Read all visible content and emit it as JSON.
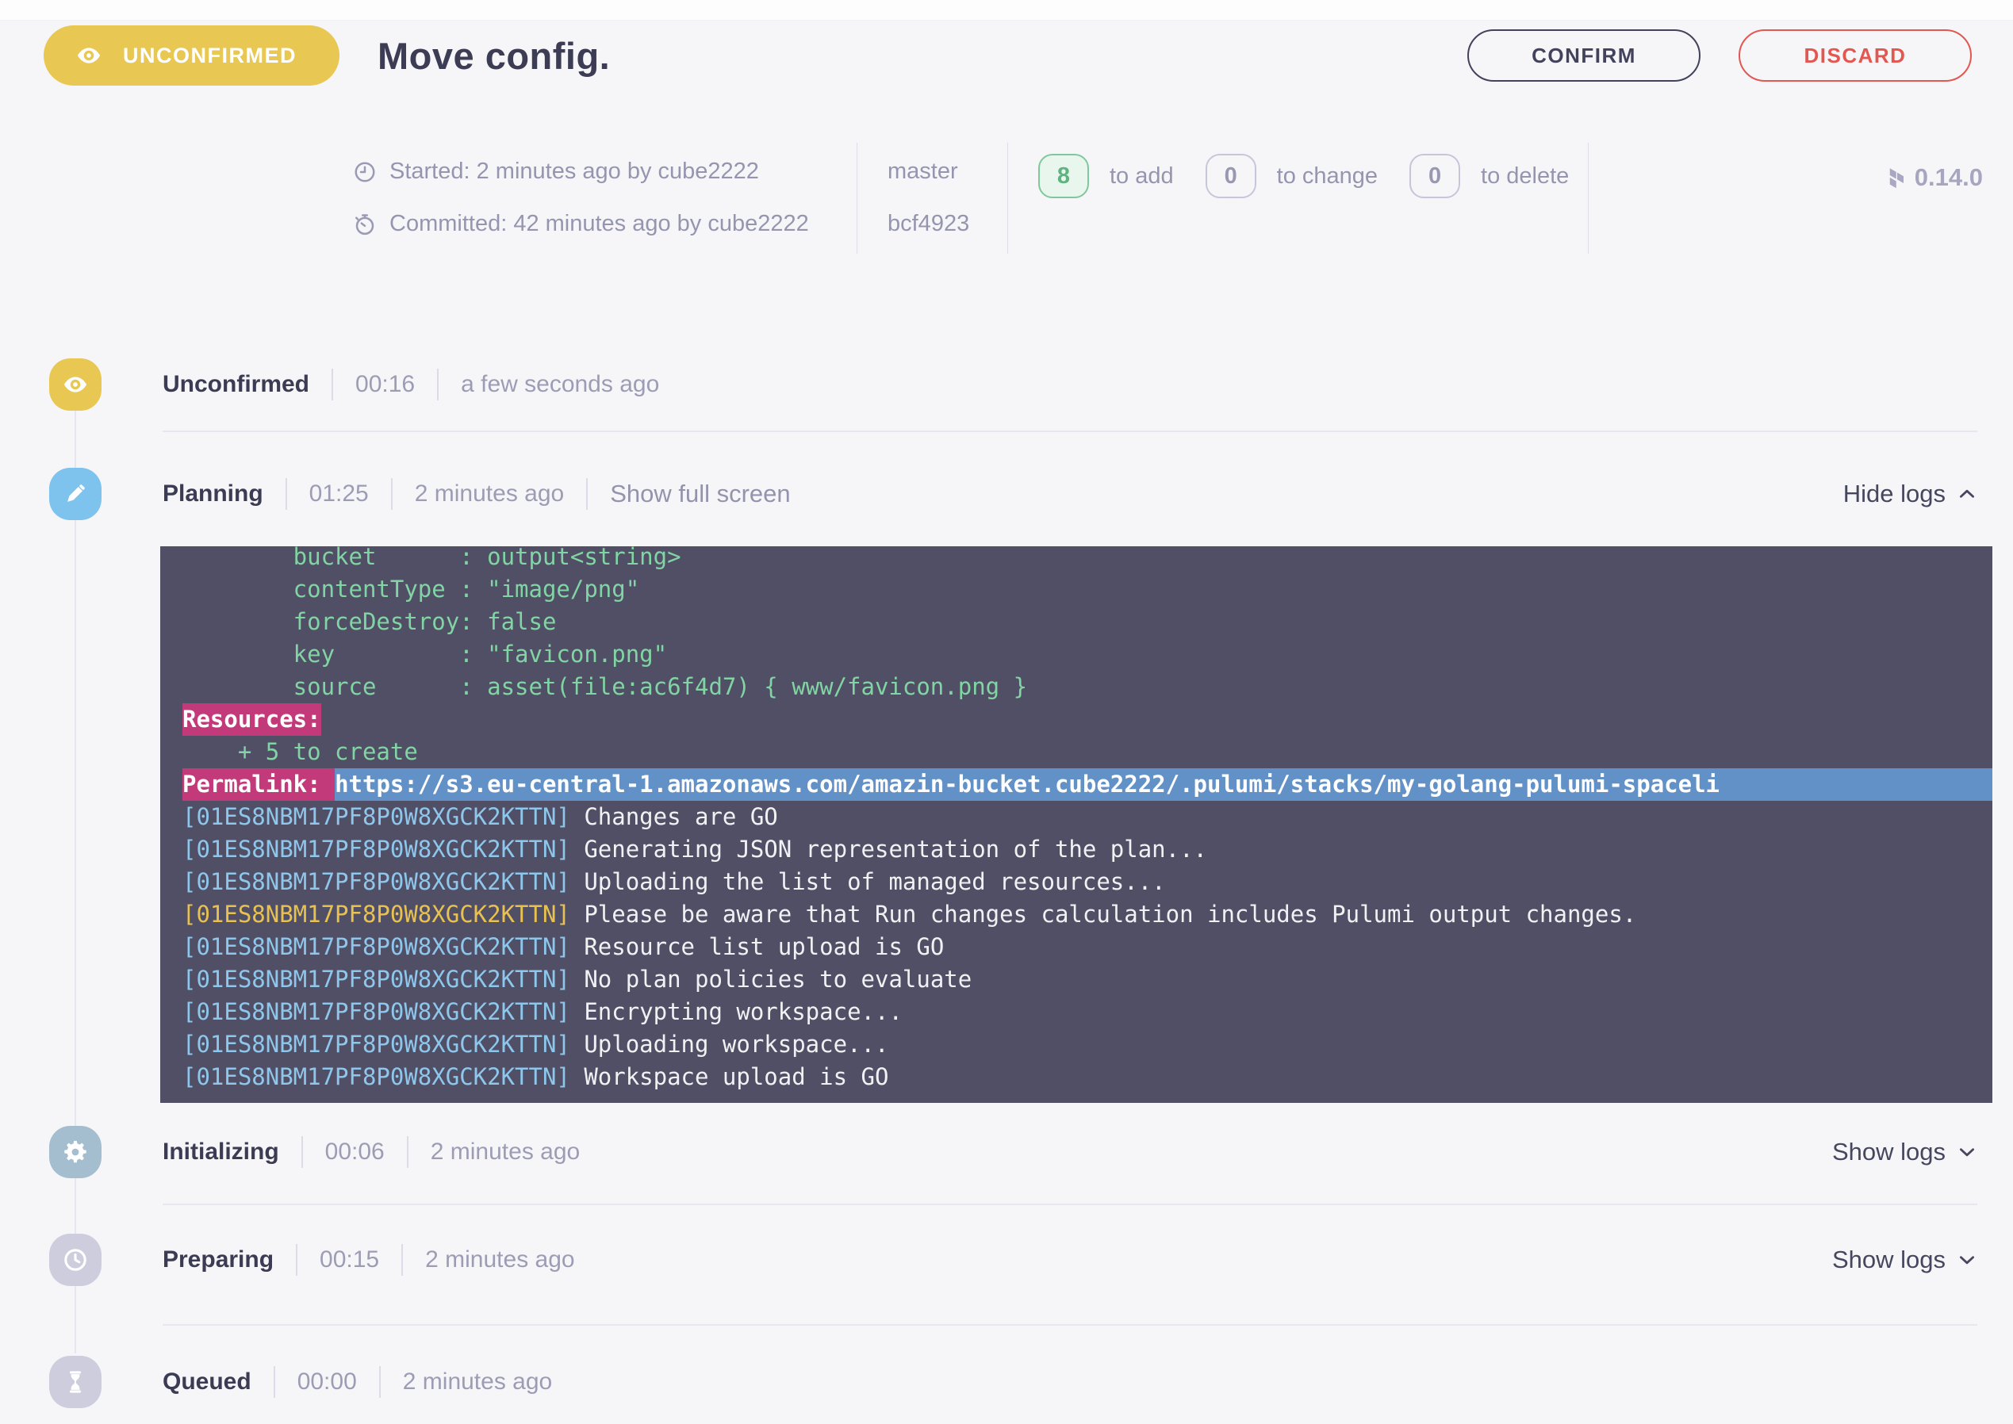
{
  "header": {
    "status_badge": "UNCONFIRMED",
    "title": "Move config.",
    "buttons": {
      "confirm": "CONFIRM",
      "discard": "DISCARD"
    }
  },
  "meta": {
    "started": "Started: 2 minutes ago by cube2222",
    "committed": "Committed: 42 minutes ago by cube2222",
    "branch": "master",
    "commit_sha": "bcf4923",
    "changes": {
      "add": {
        "count": "8",
        "label": "to add"
      },
      "change": {
        "count": "0",
        "label": "to change"
      },
      "delete": {
        "count": "0",
        "label": "to delete"
      }
    },
    "version": "0.14.0"
  },
  "stages": [
    {
      "name": "Unconfirmed",
      "duration": "00:16",
      "ago": "a few seconds ago",
      "icon": "eye-icon"
    },
    {
      "name": "Planning",
      "duration": "01:25",
      "ago": "2 minutes ago",
      "icon": "pencil-icon",
      "fullscreen": "Show full screen",
      "logs_toggle": "Hide logs",
      "logs_expanded": true
    },
    {
      "name": "Initializing",
      "duration": "00:06",
      "ago": "2 minutes ago",
      "icon": "gear-icon",
      "logs_toggle": "Show logs",
      "logs_expanded": false
    },
    {
      "name": "Preparing",
      "duration": "00:15",
      "ago": "2 minutes ago",
      "icon": "clock-icon",
      "logs_toggle": "Show logs",
      "logs_expanded": false
    },
    {
      "name": "Queued",
      "duration": "00:00",
      "ago": "2 minutes ago",
      "icon": "hourglass-icon"
    }
  ],
  "terminal": {
    "lines": [
      {
        "segments": [
          {
            "text": "        bucket      : output<string>",
            "style": "green"
          }
        ]
      },
      {
        "segments": [
          {
            "text": "        contentType : \"image/png\"",
            "style": "green"
          }
        ]
      },
      {
        "segments": [
          {
            "text": "        forceDestroy: false",
            "style": "green"
          }
        ]
      },
      {
        "segments": [
          {
            "text": "        key         : \"favicon.png\"",
            "style": "green"
          }
        ]
      },
      {
        "segments": [
          {
            "text": "        source      : asset(file:ac6f4d7) { www/favicon.png }",
            "style": "green"
          }
        ]
      },
      {
        "segments": [
          {
            "text": "Resources:",
            "style": "highlight-pink"
          }
        ]
      },
      {
        "segments": [
          {
            "text": "    + 5 to create",
            "style": "green"
          }
        ]
      },
      {
        "segments": [
          {
            "text": "Permalink: ",
            "style": "highlight-pink"
          },
          {
            "text": "https://s3.eu-central-1.amazonaws.com/amazin-bucket.cube2222/.pulumi/stacks/my-golang-pulumi-spaceli",
            "style": "highlight-blue",
            "fill": true
          }
        ]
      },
      {
        "segments": [
          {
            "text": "[01ES8NBM17PF8P0W8XGCK2KTTN]",
            "style": "blue"
          },
          {
            "text": " Changes are GO",
            "style": "white"
          }
        ]
      },
      {
        "segments": [
          {
            "text": "[01ES8NBM17PF8P0W8XGCK2KTTN]",
            "style": "blue"
          },
          {
            "text": " Generating JSON representation of the plan...",
            "style": "white"
          }
        ]
      },
      {
        "segments": [
          {
            "text": "[01ES8NBM17PF8P0W8XGCK2KTTN]",
            "style": "blue"
          },
          {
            "text": " Uploading the list of managed resources...",
            "style": "white"
          }
        ]
      },
      {
        "segments": [
          {
            "text": "[01ES8NBM17PF8P0W8XGCK2KTTN]",
            "style": "yellow"
          },
          {
            "text": " Please be aware that Run changes calculation includes Pulumi output changes.",
            "style": "white"
          }
        ]
      },
      {
        "segments": [
          {
            "text": "[01ES8NBM17PF8P0W8XGCK2KTTN]",
            "style": "blue"
          },
          {
            "text": " Resource list upload is GO",
            "style": "white"
          }
        ]
      },
      {
        "segments": [
          {
            "text": "[01ES8NBM17PF8P0W8XGCK2KTTN]",
            "style": "blue"
          },
          {
            "text": " No plan policies to evaluate",
            "style": "white"
          }
        ]
      },
      {
        "segments": [
          {
            "text": "[01ES8NBM17PF8P0W8XGCK2KTTN]",
            "style": "blue"
          },
          {
            "text": " Encrypting workspace...",
            "style": "white"
          }
        ]
      },
      {
        "segments": [
          {
            "text": "[01ES8NBM17PF8P0W8XGCK2KTTN]",
            "style": "blue"
          },
          {
            "text": " Uploading workspace...",
            "style": "white"
          }
        ]
      },
      {
        "segments": [
          {
            "text": "[01ES8NBM17PF8P0W8XGCK2KTTN]",
            "style": "blue"
          },
          {
            "text": " Workspace upload is GO",
            "style": "white"
          }
        ]
      }
    ]
  },
  "colors": {
    "status_yellow": "#e9c753",
    "planning_blue": "#7ec2ee",
    "initializing_steel": "#a4bed0",
    "pending_gray": "#cdcdde",
    "confirm_dark": "#42425c",
    "discard_red": "#e25750",
    "add_green": "#5cb57e",
    "terminal_bg": "#514f66",
    "terminal_green": "#81d4a3",
    "terminal_blue": "#8ec7ec",
    "terminal_yellow": "#e8c251",
    "highlight_pink": "#c23a79",
    "highlight_blue": "#6191c6"
  }
}
